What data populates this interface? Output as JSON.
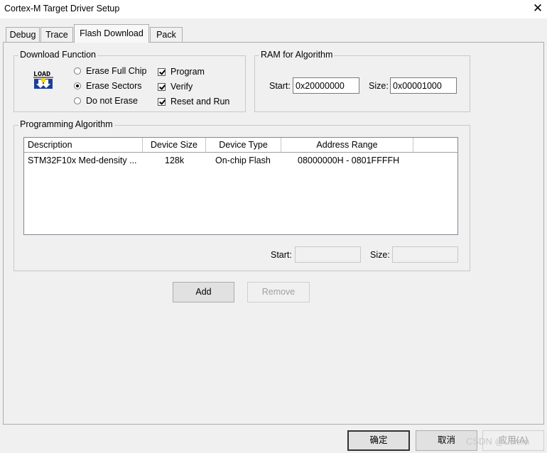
{
  "window": {
    "title": "Cortex-M Target Driver Setup",
    "close_glyph": "✕"
  },
  "tabs": [
    {
      "label": "Debug"
    },
    {
      "label": "Trace"
    },
    {
      "label": "Flash Download"
    },
    {
      "label": "Pack"
    }
  ],
  "active_tab": "Flash Download",
  "download_function": {
    "legend": "Download Function",
    "icon_text": "LOAD",
    "radios": [
      {
        "label": "Erase Full Chip",
        "checked": false
      },
      {
        "label": "Erase Sectors",
        "checked": true
      },
      {
        "label": "Do not Erase",
        "checked": false
      }
    ],
    "checkboxes": [
      {
        "label": "Program",
        "checked": true
      },
      {
        "label": "Verify",
        "checked": true
      },
      {
        "label": "Reset and Run",
        "checked": true
      }
    ]
  },
  "ram": {
    "legend": "RAM for Algorithm",
    "start_label": "Start:",
    "start_value": "0x20000000",
    "size_label": "Size:",
    "size_value": "0x00001000"
  },
  "programming": {
    "legend": "Programming Algorithm",
    "columns": [
      "Description",
      "Device Size",
      "Device Type",
      "Address Range"
    ],
    "rows": [
      {
        "description": "STM32F10x Med-density ...",
        "device_size": "128k",
        "device_type": "On-chip Flash",
        "address_range": "08000000H - 0801FFFFH"
      }
    ],
    "start_label": "Start:",
    "start_value": "",
    "size_label": "Size:",
    "size_value": ""
  },
  "buttons": {
    "add": "Add",
    "remove": "Remove",
    "ok": "确定",
    "cancel": "取消",
    "apply": "应用(A)"
  },
  "watermark": "CSDN @Lumin"
}
